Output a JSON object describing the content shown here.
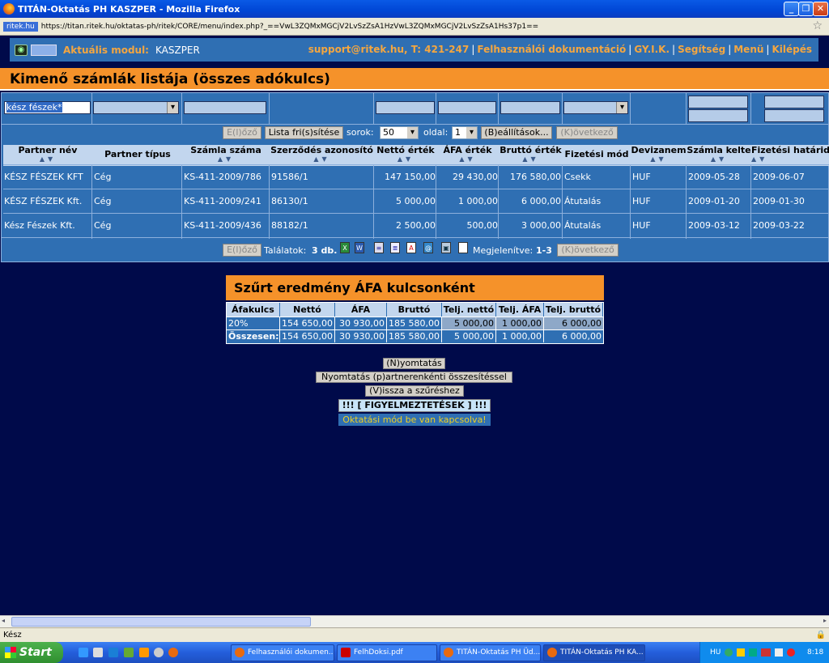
{
  "window": {
    "title": "TITÁN-Oktatás PH KASZPER - Mozilla Firefox",
    "site_badge": "ritek.hu",
    "url": "https://titan.ritek.hu/oktatas-ph/ritek/CORE/menu/index.php?_==VwL3ZQMxMGCjV2LvSzZsA1HzVwL3ZQMxMGCjV2LvSzZsA1Hs37p1=="
  },
  "topnav": {
    "module_label": "Aktuális modul:",
    "module_name": "KASZPER",
    "support": "support@ritek.hu, T: 421-247",
    "links": [
      "Felhasználói dokumentáció",
      "GY.I.K.",
      "Segítség",
      "Menü",
      "Kilépés"
    ]
  },
  "page_title": "Kimenő számlák listája (összes adókulcs)",
  "filters": {
    "partner_name_value": "kész fészek*"
  },
  "pager": {
    "prev": "E(l)őző",
    "refresh": "Lista fri(s)sítése",
    "rows_label": "sorok:",
    "rows_value": "50",
    "page_label": "oldal:",
    "page_value": "1",
    "settings": "(B)eállítások...",
    "next": "(K)övetkező"
  },
  "table": {
    "headers": [
      "Partner név",
      "Partner típus",
      "Számla száma",
      "Szerződés azonosító",
      "Nettó érték",
      "ÁFA érték",
      "Bruttó érték",
      "Fizetési mód",
      "Devizanem",
      "Számla kelte",
      "Fizetési határidő"
    ],
    "rows": [
      [
        "KÉSZ FÉSZEK KFT",
        "Cég",
        "KS-411-2009/786",
        "91586/1",
        "147 150,00",
        "29 430,00",
        "176 580,00",
        "Csekk",
        "HUF",
        "2009-05-28",
        "2009-06-07"
      ],
      [
        "KÉSZ FÉSZEK Kft.",
        "Cég",
        "KS-411-2009/241",
        "86130/1",
        "5 000,00",
        "1 000,00",
        "6 000,00",
        "Átutalás",
        "HUF",
        "2009-01-20",
        "2009-01-30"
      ],
      [
        "Kész Fészek Kft.",
        "Cég",
        "KS-411-2009/436",
        "88182/1",
        "2 500,00",
        "500,00",
        "3 000,00",
        "Átutalás",
        "HUF",
        "2009-03-12",
        "2009-03-22"
      ]
    ]
  },
  "results": {
    "prev": "E(l)őző",
    "label": "Találatok:",
    "count": "3 db.",
    "shown_label": "Megjelenítve:",
    "shown": "1-3",
    "next": "(K)övetkező"
  },
  "vat_summary": {
    "title": "Szűrt eredmény ÁFA kulcsonként",
    "headers": [
      "Áfakulcs",
      "Nettó",
      "ÁFA",
      "Bruttó",
      "Telj. nettó",
      "Telj. ÁFA",
      "Telj. bruttó"
    ],
    "rows": [
      [
        "20%",
        "154 650,00",
        "30 930,00",
        "185 580,00",
        "5 000,00",
        "1 000,00",
        "6 000,00"
      ],
      [
        "Összesen:",
        "154 650,00",
        "30 930,00",
        "185 580,00",
        "5 000,00",
        "1 000,00",
        "6 000,00"
      ]
    ]
  },
  "actions": {
    "print": "(N)yomtatás",
    "print_partner": "Nyomtatás (p)artnerenkénti összesítéssel",
    "back": "(V)issza a szűréshez",
    "warnings": "!!! [ FIGYELMEZTETÉSEK ] !!!",
    "training_mode": "Oktatási mód be van kapcsolva!"
  },
  "status_text": "Kész",
  "taskbar": {
    "start": "Start",
    "tasks": [
      "Felhasználói dokumen...",
      "FelhDoksi.pdf",
      "TITÁN-Oktatás PH Üd...",
      "TITÁN-Oktatás PH KA..."
    ],
    "lang": "HU",
    "clock": "8:18"
  },
  "colors": {
    "accent_orange": "#f5922a",
    "panel_blue": "#2f6fb3",
    "page_bg": "#000a4a",
    "link_orange": "#f4a640"
  }
}
